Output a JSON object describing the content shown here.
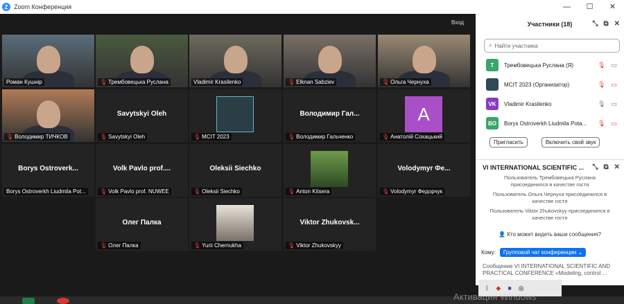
{
  "window": {
    "title": "Zoom Конференция",
    "logo_letter": "Z",
    "minimize": "—",
    "maximize": "☐",
    "close": "✕"
  },
  "gallery": {
    "view_label": "Вход",
    "tiles": [
      {
        "name": "Роман Кушнір",
        "type": "video",
        "muted": false,
        "bg": "#5a6d7a"
      },
      {
        "name": "Трембовецька Руслана",
        "type": "video",
        "muted": true,
        "bg": "#4b5a3e"
      },
      {
        "name": "Vladimir Krasilenko",
        "type": "video",
        "muted": false,
        "bg": "#6e6a5e",
        "active": true
      },
      {
        "name": "Elknan Sabziev",
        "type": "video",
        "muted": true,
        "bg": "#7a6f68"
      },
      {
        "name": "Ольга Чернуха",
        "type": "video",
        "muted": true,
        "bg": "#9a8a74"
      },
      {
        "name": "Володимир ТИЧКОВ",
        "type": "video",
        "muted": true,
        "bg": "#b07a55"
      },
      {
        "name": "Savytskyi Oleh",
        "display": "Savytskyi Oleh",
        "type": "name",
        "muted": true
      },
      {
        "name": "MCIT 2023",
        "type": "logo",
        "muted": true
      },
      {
        "name": "Володимир Гальченко",
        "display": "Володимир Гал...",
        "type": "name",
        "muted": true
      },
      {
        "name": "Анатолій Сохацький",
        "type": "avatar",
        "avatar_letter": "A",
        "muted": true
      },
      {
        "name": "Borys Ostroverkh Liudmila Pot...",
        "display": "Borys Ostroverk...",
        "type": "name",
        "muted": false
      },
      {
        "name": "Volk Pavlo prof. NUWEE",
        "display": "Volk Pavlo prof....",
        "type": "name",
        "muted": true
      },
      {
        "name": "Oleksii Siechko",
        "display": "Oleksii Siechko",
        "type": "name",
        "muted": true
      },
      {
        "name": "Anton Kitsera",
        "type": "photo",
        "muted": true
      },
      {
        "name": "Volodymyr Федорчук",
        "display": "Volodymyr Фе...",
        "type": "name",
        "muted": true
      },
      {
        "name": "Олег Палка",
        "display": "Олег Палка",
        "type": "name",
        "muted": true
      },
      {
        "name": "Yurii Chernukha",
        "type": "portrait",
        "muted": true
      },
      {
        "name": "Viktor Zhukovskyy",
        "display": "Viktor Zhukovsk...",
        "type": "name",
        "muted": true
      }
    ]
  },
  "participants": {
    "title": "Участники (18)",
    "search_placeholder": "Найти участника",
    "list": [
      {
        "initials": "T",
        "name": "Трембовецька Руслана (Я)",
        "color": "#3aa56a"
      },
      {
        "initials": "",
        "name": "MCIT 2023 (Организатор)",
        "color": "#2e4a55"
      },
      {
        "initials": "VK",
        "name": "Vladimir Krasilenko",
        "color": "#8a3bbf"
      },
      {
        "initials": "BO",
        "name": "Borys Ostroverkh Liudmila Pota...",
        "color": "#3aa56a"
      }
    ],
    "invite_label": "Пригласить",
    "unmute_label": "Включить свой звук"
  },
  "chat": {
    "title": "VI INTERNATIONAL SCIENTIFIC ...",
    "messages": [
      "Пользователь Трембовецька Руслана присоединился в качестве гостя",
      "Пользователь Ольга Чернуха присоединился в качестве гостя",
      "Пользователь Viktor Zhukovskyy присоединился в качестве гостя"
    ],
    "visibility_label": "Кто может видеть ваши сообщения?",
    "to_label": "Кому:",
    "to_value": "Групповой чат конференции",
    "compose_text": "Сообщение VI INTERNATIONAL SCIENTIFIC AND PRACTICAL CONFERENCE «Modeling, control ..."
  },
  "os": {
    "activation_text": "Активация Windows"
  }
}
